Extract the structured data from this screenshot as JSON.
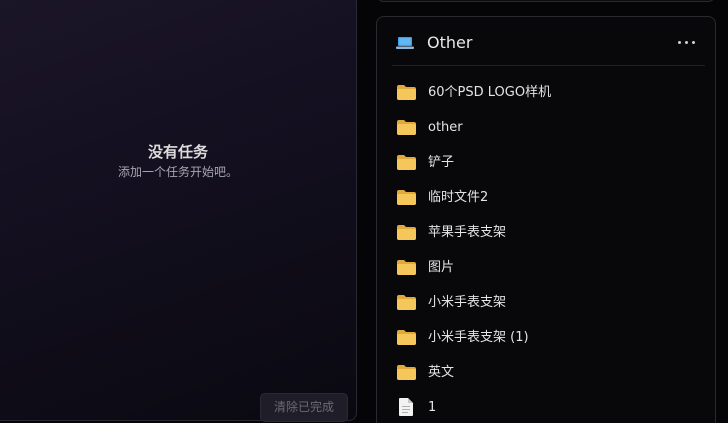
{
  "tasks": {
    "empty_title": "没有任务",
    "empty_subtitle": "添加一个任务开始吧。",
    "clear_label": "清除已完成"
  },
  "folder_panel": {
    "title": "Other",
    "title_icon": "laptop-icon",
    "more_icon": "more-horizontal-icon",
    "items": [
      {
        "label": "60个PSD LOGO样机",
        "icon": "folder-icon"
      },
      {
        "label": "other",
        "icon": "folder-icon"
      },
      {
        "label": "铲子",
        "icon": "folder-icon"
      },
      {
        "label": "临时文件2",
        "icon": "folder-icon"
      },
      {
        "label": "苹果手表支架",
        "icon": "folder-icon"
      },
      {
        "label": "图片",
        "icon": "folder-icon"
      },
      {
        "label": "小米手表支架",
        "icon": "folder-icon"
      },
      {
        "label": "小米手表支架 (1)",
        "icon": "folder-icon"
      },
      {
        "label": "英文",
        "icon": "folder-icon"
      },
      {
        "label": "1",
        "icon": "document-icon"
      }
    ]
  },
  "colors": {
    "folder": "#f5c65a",
    "folder_shade": "#e0a93a",
    "laptop_screen": "#3aa0e8",
    "laptop_base": "#8fb8d8",
    "document": "#f2f2f2"
  }
}
